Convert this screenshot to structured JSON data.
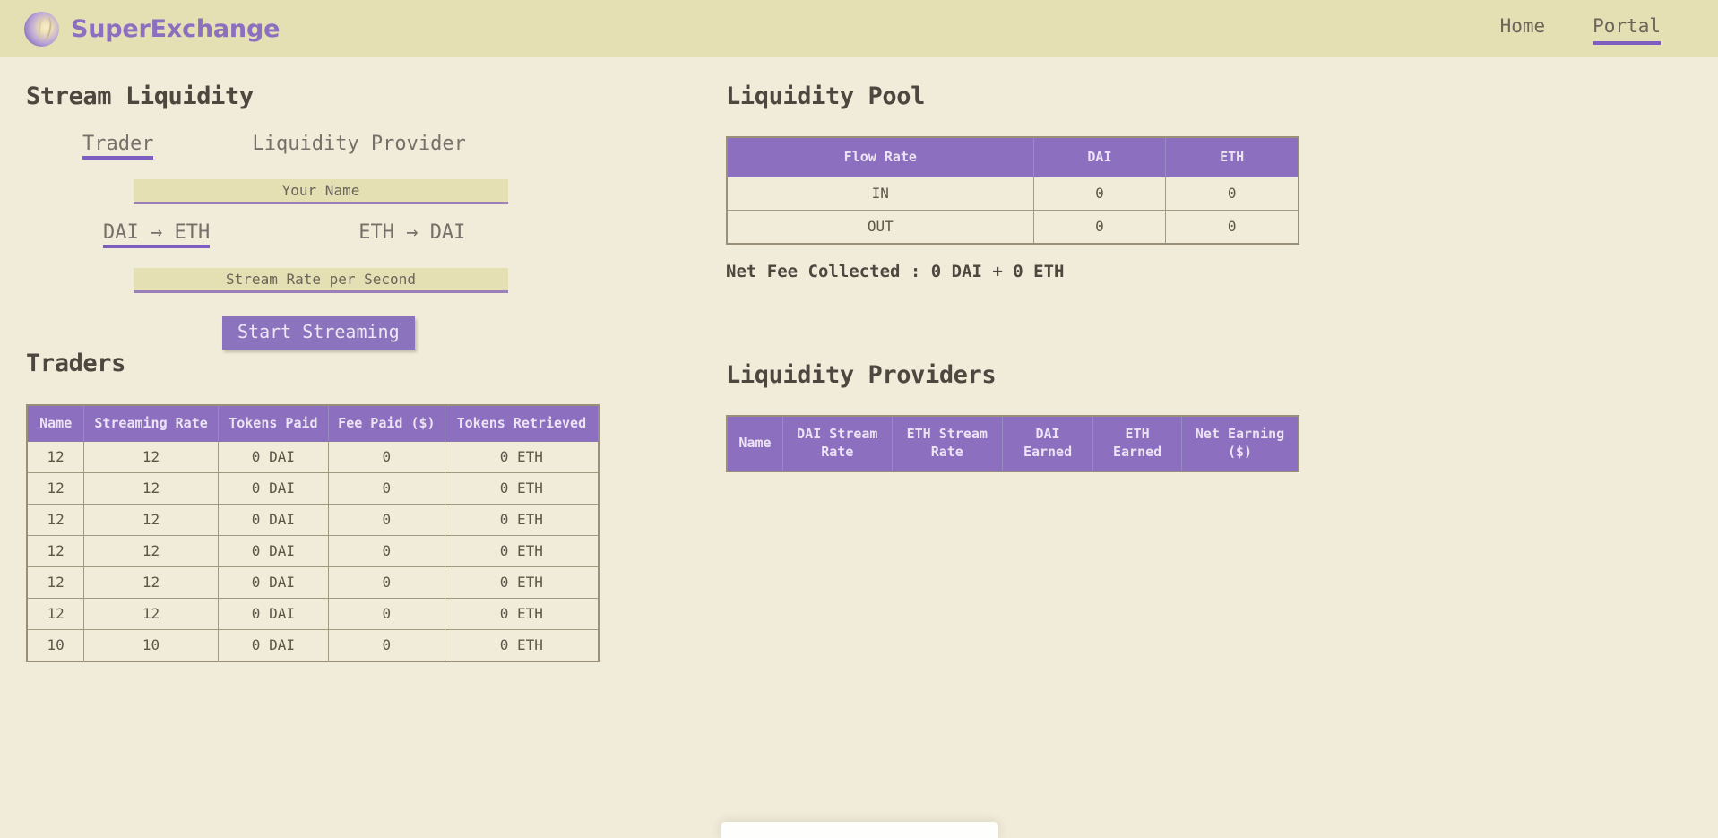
{
  "header": {
    "brand_name": "SuperExchange",
    "logo_icon": "coin-swirl-icon",
    "nav": [
      {
        "label": "Home",
        "active": false
      },
      {
        "label": "Portal",
        "active": true
      }
    ]
  },
  "colors": {
    "accent_purple": "#8c6fbf",
    "underline_purple": "#7e5fc0",
    "header_bg": "#e5dfb4",
    "body_bg": "#f0ecd9",
    "text": "#5c5448",
    "table_border": "#9a9079"
  },
  "stream_liquidity": {
    "title": "Stream Liquidity",
    "role_tabs": [
      {
        "label": "Trader",
        "active": true
      },
      {
        "label": "Liquidity Provider",
        "active": false
      }
    ],
    "name_input": {
      "value": "",
      "placeholder": "Your Name"
    },
    "direction_tabs": [
      {
        "label": "DAI → ETH",
        "active": true
      },
      {
        "label": "ETH → DAI",
        "active": false
      }
    ],
    "rate_input": {
      "value": "",
      "placeholder": "Stream Rate per Second"
    },
    "submit_label": "Start Streaming"
  },
  "liquidity_pool": {
    "title": "Liquidity Pool",
    "columns": [
      "Flow Rate",
      "DAI",
      "ETH"
    ],
    "rows": [
      [
        "IN",
        "0",
        "0"
      ],
      [
        "OUT",
        "0",
        "0"
      ]
    ],
    "net_fee": "Net Fee Collected : 0 DAI + 0 ETH"
  },
  "traders": {
    "title": "Traders",
    "columns": [
      "Name",
      "Streaming Rate",
      "Tokens Paid",
      "Fee Paid ($)",
      "Tokens Retrieved"
    ],
    "rows": [
      [
        "12",
        "12",
        "0 DAI",
        "0",
        "0 ETH"
      ],
      [
        "12",
        "12",
        "0 DAI",
        "0",
        "0 ETH"
      ],
      [
        "12",
        "12",
        "0 DAI",
        "0",
        "0 ETH"
      ],
      [
        "12",
        "12",
        "0 DAI",
        "0",
        "0 ETH"
      ],
      [
        "12",
        "12",
        "0 DAI",
        "0",
        "0 ETH"
      ],
      [
        "12",
        "12",
        "0 DAI",
        "0",
        "0 ETH"
      ],
      [
        "10",
        "10",
        "0 DAI",
        "0",
        "0 ETH"
      ]
    ]
  },
  "liquidity_providers": {
    "title": "Liquidity Providers",
    "columns": [
      "Name",
      "DAI Stream Rate",
      "ETH Stream Rate",
      "DAI Earned",
      "ETH Earned",
      "Net Earning ($)"
    ],
    "rows": []
  }
}
